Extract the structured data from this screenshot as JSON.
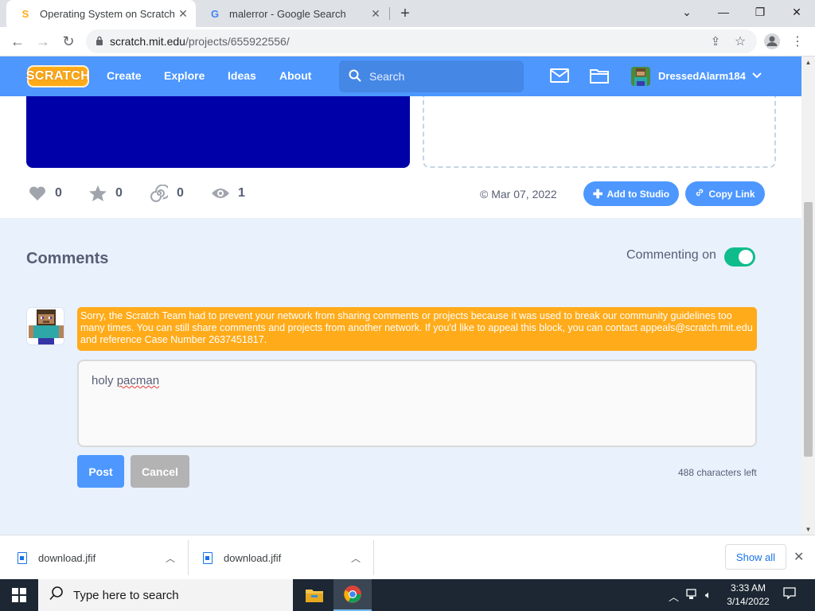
{
  "browser": {
    "tabs": [
      {
        "title": "Operating System on Scratch",
        "favicon": "S",
        "favicon_color": "#ffab19",
        "active": true
      },
      {
        "title": "malerror - Google Search",
        "favicon": "G",
        "favicon_color": "#4285f4",
        "active": false
      }
    ],
    "new_tab_label": "+",
    "url_host": "scratch.mit.edu",
    "url_path": "/projects/655922556/"
  },
  "scratch_nav": {
    "logo_text": "SCRATCH",
    "links": [
      "Create",
      "Explore",
      "Ideas",
      "About"
    ],
    "search_placeholder": "Search",
    "username": "DressedAlarm184"
  },
  "project_stats": {
    "loves": "0",
    "favorites": "0",
    "remixes": "0",
    "views": "1",
    "date": "Mar 07, 2022",
    "add_to_studio": "Add to Studio",
    "copy_link": "Copy Link"
  },
  "comments": {
    "title": "Comments",
    "commenting_label": "Commenting on",
    "commenting_enabled": true,
    "alert_text": "Sorry, the Scratch Team had to prevent your network from sharing comments or projects because it was used to break our community guidelines too many times. You can still share comments and projects from another network. If you'd like to appeal this block, you can contact appeals@scratch.mit.edu and reference Case Number 2637451817.",
    "draft_prefix": "holy ",
    "draft_misspelled": "pacman",
    "post_label": "Post",
    "cancel_label": "Cancel",
    "chars_left": "488 characters left"
  },
  "downloads": {
    "items": [
      "download.jfif",
      "download.jfif"
    ],
    "show_all": "Show all"
  },
  "taskbar": {
    "search_placeholder": "Type here to search",
    "time": "3:33 AM",
    "date": "3/14/2022"
  },
  "colors": {
    "scratch_blue": "#4d97ff",
    "alert_orange": "#ffab1a",
    "toggle_green": "#0fbd8c",
    "stage_blue": "#0000a8"
  }
}
